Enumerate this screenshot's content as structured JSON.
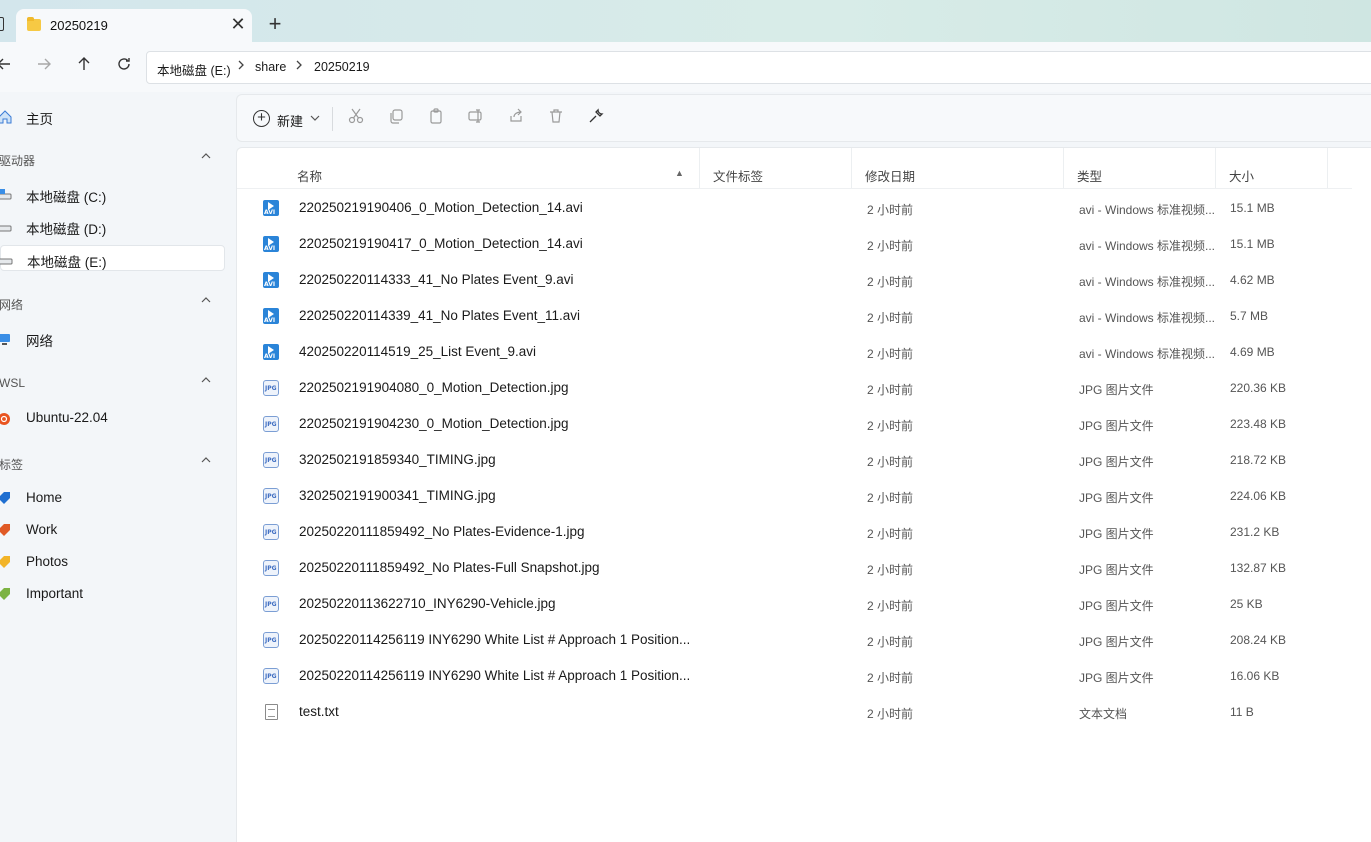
{
  "tab": {
    "title": "20250219",
    "close_glyph": "✕",
    "new_glyph": "+"
  },
  "nav": {
    "back_icon": "arrow-left-icon",
    "forward_icon": "arrow-right-icon",
    "up_icon": "arrow-up-icon",
    "refresh_icon": "refresh-icon",
    "breadcrumb": [
      "本地磁盘 (E:)",
      "share",
      "20250219"
    ]
  },
  "sidebar": {
    "home": "主页",
    "sections": {
      "drives": "驱动器",
      "network": "网络",
      "wsl": "WSL",
      "tags": "标签"
    },
    "drives": [
      "本地磁盘 (C:)",
      "本地磁盘 (D:)",
      "本地磁盘 (E:)"
    ],
    "network": [
      "网络"
    ],
    "wsl": [
      "Ubuntu-22.04"
    ],
    "tags": [
      {
        "label": "Home",
        "color": "#1f6fd1"
      },
      {
        "label": "Work",
        "color": "#e05a26"
      },
      {
        "label": "Photos",
        "color": "#f2b429"
      },
      {
        "label": "Important",
        "color": "#7cb342"
      }
    ]
  },
  "toolbar": {
    "new_label": "新建"
  },
  "columns": {
    "name": "名称",
    "tags": "文件标签",
    "modified": "修改日期",
    "type": "类型",
    "size": "大小"
  },
  "files": [
    {
      "name": "220250219190406_0_Motion_Detection_14.avi",
      "date": "2 小时前",
      "type": "avi - Windows 标准视频...",
      "size": "15.1 MB",
      "icon": "avi"
    },
    {
      "name": "220250219190417_0_Motion_Detection_14.avi",
      "date": "2 小时前",
      "type": "avi - Windows 标准视频...",
      "size": "15.1 MB",
      "icon": "avi"
    },
    {
      "name": "220250220114333_41_No Plates Event_9.avi",
      "date": "2 小时前",
      "type": "avi - Windows 标准视频...",
      "size": "4.62 MB",
      "icon": "avi"
    },
    {
      "name": "220250220114339_41_No Plates Event_11.avi",
      "date": "2 小时前",
      "type": "avi - Windows 标准视频...",
      "size": "5.7 MB",
      "icon": "avi"
    },
    {
      "name": "420250220114519_25_List Event_9.avi",
      "date": "2 小时前",
      "type": "avi - Windows 标准视频...",
      "size": "4.69 MB",
      "icon": "avi"
    },
    {
      "name": "2202502191904080_0_Motion_Detection.jpg",
      "date": "2 小时前",
      "type": "JPG 图片文件",
      "size": "220.36 KB",
      "icon": "jpg"
    },
    {
      "name": "2202502191904230_0_Motion_Detection.jpg",
      "date": "2 小时前",
      "type": "JPG 图片文件",
      "size": "223.48 KB",
      "icon": "jpg"
    },
    {
      "name": "3202502191859340_TIMING.jpg",
      "date": "2 小时前",
      "type": "JPG 图片文件",
      "size": "218.72 KB",
      "icon": "jpg"
    },
    {
      "name": "3202502191900341_TIMING.jpg",
      "date": "2 小时前",
      "type": "JPG 图片文件",
      "size": "224.06 KB",
      "icon": "jpg"
    },
    {
      "name": "20250220111859492_No Plates-Evidence-1.jpg",
      "date": "2 小时前",
      "type": "JPG 图片文件",
      "size": "231.2 KB",
      "icon": "jpg"
    },
    {
      "name": "20250220111859492_No Plates-Full Snapshot.jpg",
      "date": "2 小时前",
      "type": "JPG 图片文件",
      "size": "132.87 KB",
      "icon": "jpg"
    },
    {
      "name": "20250220113622710_INY6290-Vehicle.jpg",
      "date": "2 小时前",
      "type": "JPG 图片文件",
      "size": "25 KB",
      "icon": "jpg"
    },
    {
      "name": "20250220114256119 INY6290 White List # Approach 1 Position...",
      "date": "2 小时前",
      "type": "JPG 图片文件",
      "size": "208.24 KB",
      "icon": "jpg"
    },
    {
      "name": "20250220114256119 INY6290 White List # Approach 1 Position...",
      "date": "2 小时前",
      "type": "JPG 图片文件",
      "size": "16.06 KB",
      "icon": "jpg"
    },
    {
      "name": "test.txt",
      "date": "2 小时前",
      "type": "文本文档",
      "size": "11 B",
      "icon": "txt"
    }
  ]
}
